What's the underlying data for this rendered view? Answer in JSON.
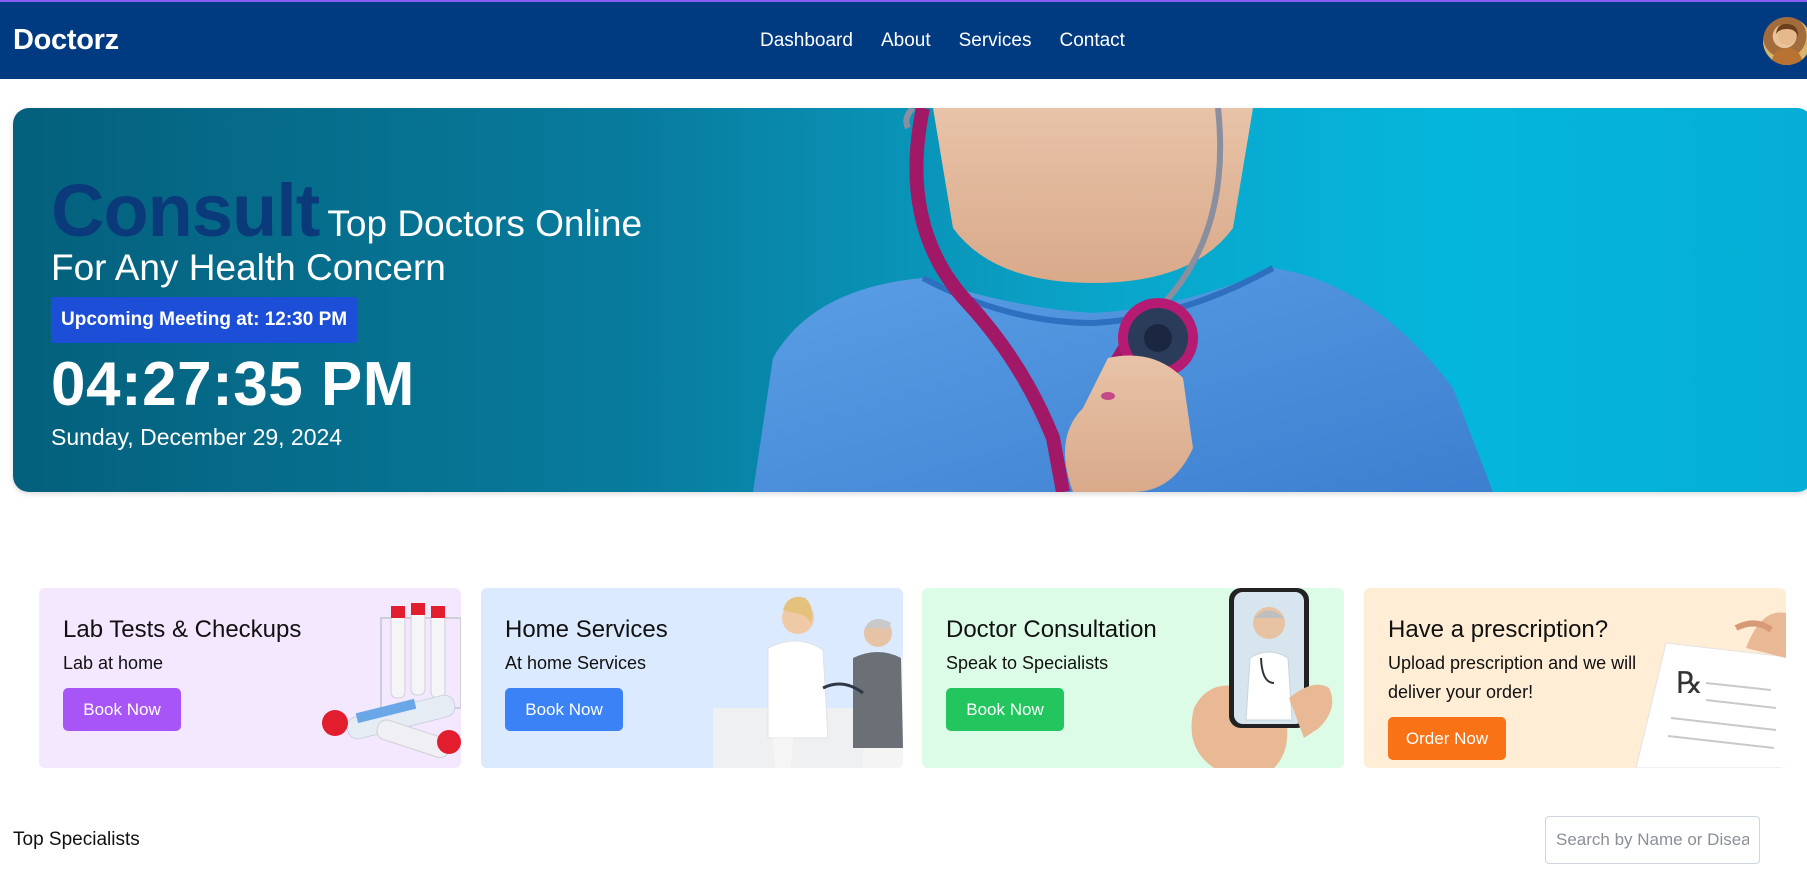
{
  "navbar": {
    "brand": "Doctorz",
    "links": [
      "Dashboard",
      "About",
      "Services",
      "Contact"
    ]
  },
  "hero": {
    "headline_strong": "Consult",
    "headline_rest": "Top Doctors Online",
    "headline_line2": "For Any Health Concern",
    "meeting_badge": "Upcoming Meeting at: 12:30 PM",
    "clock": "04:27:35 PM",
    "date": "Sunday, December 29, 2024"
  },
  "cards": [
    {
      "title": "Lab Tests & Checkups",
      "subtitle": "Lab at home",
      "button": "Book Now",
      "bg": "#f3e8ff",
      "btn_color": "#a855f7"
    },
    {
      "title": "Home Services",
      "subtitle": "At home Services",
      "button": "Book Now",
      "bg": "#dbeafe",
      "btn_color": "#3b82f6"
    },
    {
      "title": "Doctor Consultation",
      "subtitle": "Speak to Specialists",
      "button": "Book Now",
      "bg": "#dcfce7",
      "btn_color": "#22c55e"
    },
    {
      "title": "Have a prescription?",
      "subtitle": "Upload prescription and we will deliver your order!",
      "button": "Order Now",
      "bg": "#ffedd5",
      "btn_color": "#f97316"
    }
  ],
  "specialists": {
    "title": "Top Specialists",
    "search_placeholder": "Search by Name or Disease"
  },
  "colors": {
    "navbar": "#003a80",
    "consult_text": "#0b3a7a",
    "meeting_badge": "#1d4ed8"
  }
}
